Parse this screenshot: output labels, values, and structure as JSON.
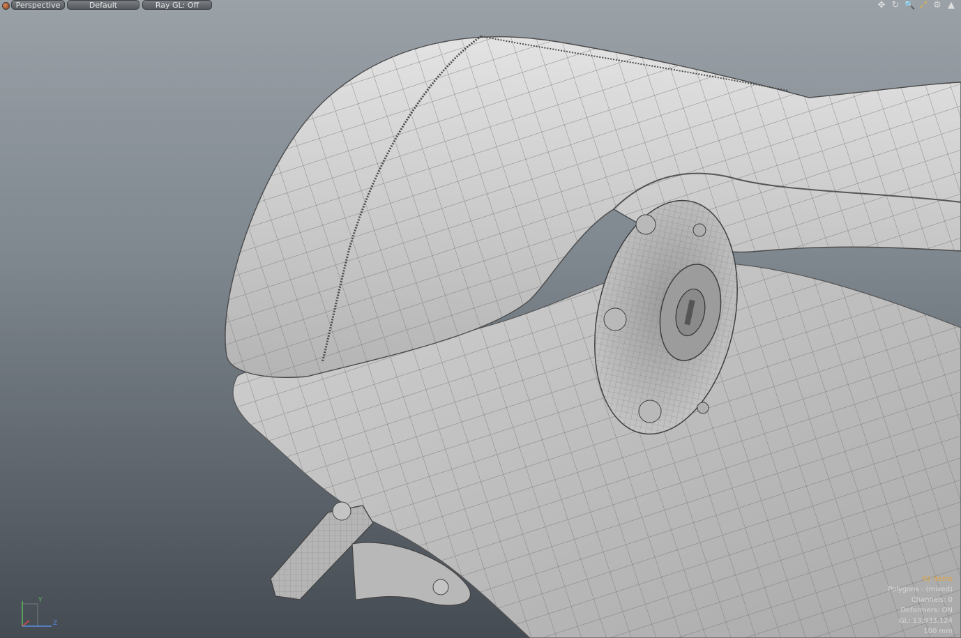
{
  "toolbar": {
    "view_label": "Perspective",
    "style_label": "Default",
    "raygl_label": "Ray GL: Off"
  },
  "viewport_tools": [
    {
      "name": "pan-icon",
      "glyph": "✥"
    },
    {
      "name": "rotate-icon",
      "glyph": "↻"
    },
    {
      "name": "zoom-icon",
      "glyph": "🔍"
    },
    {
      "name": "fit-icon",
      "glyph": "⤢"
    },
    {
      "name": "settings-icon",
      "glyph": "⚙"
    },
    {
      "name": "maximize-icon",
      "glyph": "▲"
    }
  ],
  "stats": {
    "items": "42 Items",
    "polygons": "Polygons : (mixed)",
    "channels": "Channels: 0",
    "deformers": "Deformers: ON",
    "gl": "GL: 13,933,124",
    "unit": "100 mm"
  },
  "axis": {
    "y_label": "Y",
    "z_label": "Z"
  },
  "colors": {
    "background_top": "#9aa1a7",
    "background_bottom": "#454b52",
    "items_highlight": "#e6a43a",
    "model_surface": "#c9c9c9"
  }
}
